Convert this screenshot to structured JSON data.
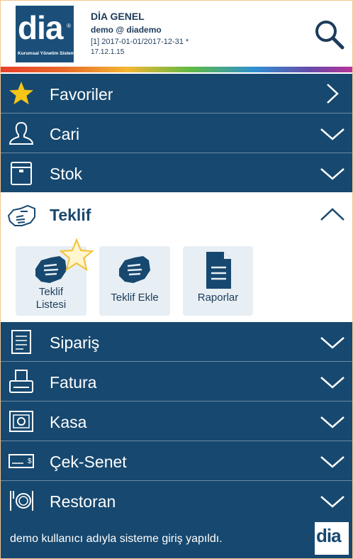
{
  "header": {
    "logo_text": "dia",
    "logo_tagline": "Kurumsal Yönetim Sistemi",
    "title": "DİA GENEL",
    "user": "demo @ diademo",
    "period": "[1] 2017-01-01/2017-12-31 *",
    "version": "17.12.1.15",
    "search_icon": "search-icon"
  },
  "menu": [
    {
      "label": "Favoriler",
      "icon": "star-icon",
      "chevron": "right"
    },
    {
      "label": "Cari",
      "icon": "person-icon",
      "chevron": "down"
    },
    {
      "label": "Stok",
      "icon": "box-icon",
      "chevron": "down"
    },
    {
      "label": "Teklif",
      "icon": "handshake-icon",
      "chevron": "up",
      "expanded": true
    },
    {
      "label": "Sipariş",
      "icon": "document-list-icon",
      "chevron": "down"
    },
    {
      "label": "Fatura",
      "icon": "receipt-printer-icon",
      "chevron": "down"
    },
    {
      "label": "Kasa",
      "icon": "safe-icon",
      "chevron": "down"
    },
    {
      "label": "Çek-Senet",
      "icon": "check-icon",
      "chevron": "down"
    },
    {
      "label": "Restoran",
      "icon": "cutlery-icon",
      "chevron": "down"
    }
  ],
  "submenu": [
    {
      "label": "Teklif Listesi",
      "icon": "handshake-icon",
      "favorite": true
    },
    {
      "label": "Teklif Ekle",
      "icon": "handshake-icon",
      "favorite": false
    },
    {
      "label": "Raporlar",
      "icon": "report-icon",
      "favorite": false
    }
  ],
  "footer": {
    "message": "demo kullanıcı adıyla sisteme giriş yapıldı.",
    "logo_text": "dia"
  },
  "colors": {
    "menu_bg": "#17486f",
    "accent_star": "#f5c518",
    "tile_bg": "#e7eef4"
  }
}
